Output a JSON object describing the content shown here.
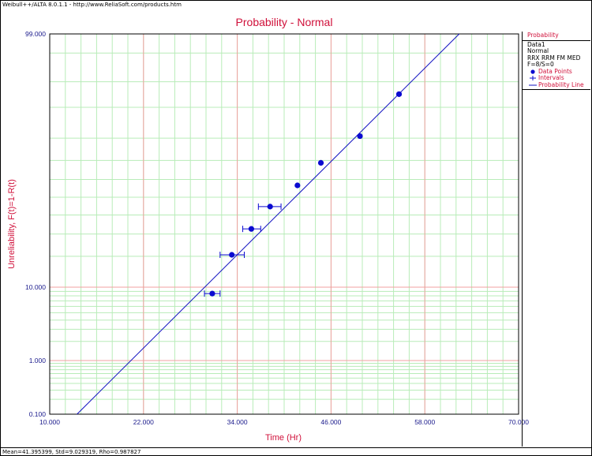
{
  "window": {
    "title": "Weibull++/ALTA 8.0.1.1 - http://www.ReliaSoft.com/products.htm",
    "status": "Mean=41.395399, Std=9.029319, Rho=0.987827"
  },
  "legend": {
    "header": "Probability",
    "lines": [
      "Data1",
      "Normal",
      "RRX RRM FM MED",
      "F=8/S=0"
    ],
    "items": [
      {
        "label": "Data Points",
        "symbol": "dot"
      },
      {
        "label": "Intervals",
        "symbol": "interval"
      },
      {
        "label": "Probability Line",
        "symbol": "line"
      }
    ]
  },
  "colors": {
    "title": "#d0103a",
    "axis_text": "#1a1a8c",
    "line": "#1010c0",
    "points": "#0a0ad0",
    "major_grid": "#f0a0a0",
    "minor_grid": "#b8ecb8"
  },
  "chart_data": {
    "type": "scatter",
    "title": "Probability - Normal",
    "xlabel": "Time (Hr)",
    "ylabel": "Unreliability, F(t)=1-R(t)",
    "xlim": [
      10,
      70
    ],
    "ylim": [
      0.1,
      99
    ],
    "yscale": "normal-probability",
    "x_ticks": [
      "10.000",
      "22.000",
      "34.000",
      "46.000",
      "58.000",
      "70.000"
    ],
    "y_ticks": [
      "0.100",
      "1.000",
      "10.000",
      "99.000"
    ],
    "grid": true,
    "legend_position": "right",
    "points": [
      {
        "x": 30.8,
        "y": 8.5,
        "xerr": [
          29.8,
          31.8
        ]
      },
      {
        "x": 33.3,
        "y": 20.6,
        "xerr": [
          31.8,
          34.9
        ]
      },
      {
        "x": 35.8,
        "y": 32.6,
        "xerr": [
          34.7,
          37.0
        ]
      },
      {
        "x": 38.2,
        "y": 44.7,
        "xerr": [
          36.7,
          39.6
        ]
      },
      {
        "x": 41.7,
        "y": 56.7
      },
      {
        "x": 44.7,
        "y": 68.8
      },
      {
        "x": 49.7,
        "y": 80.8
      },
      {
        "x": 54.7,
        "y": 92.9
      }
    ],
    "line": {
      "mean": 41.395399,
      "std": 9.029319
    }
  }
}
